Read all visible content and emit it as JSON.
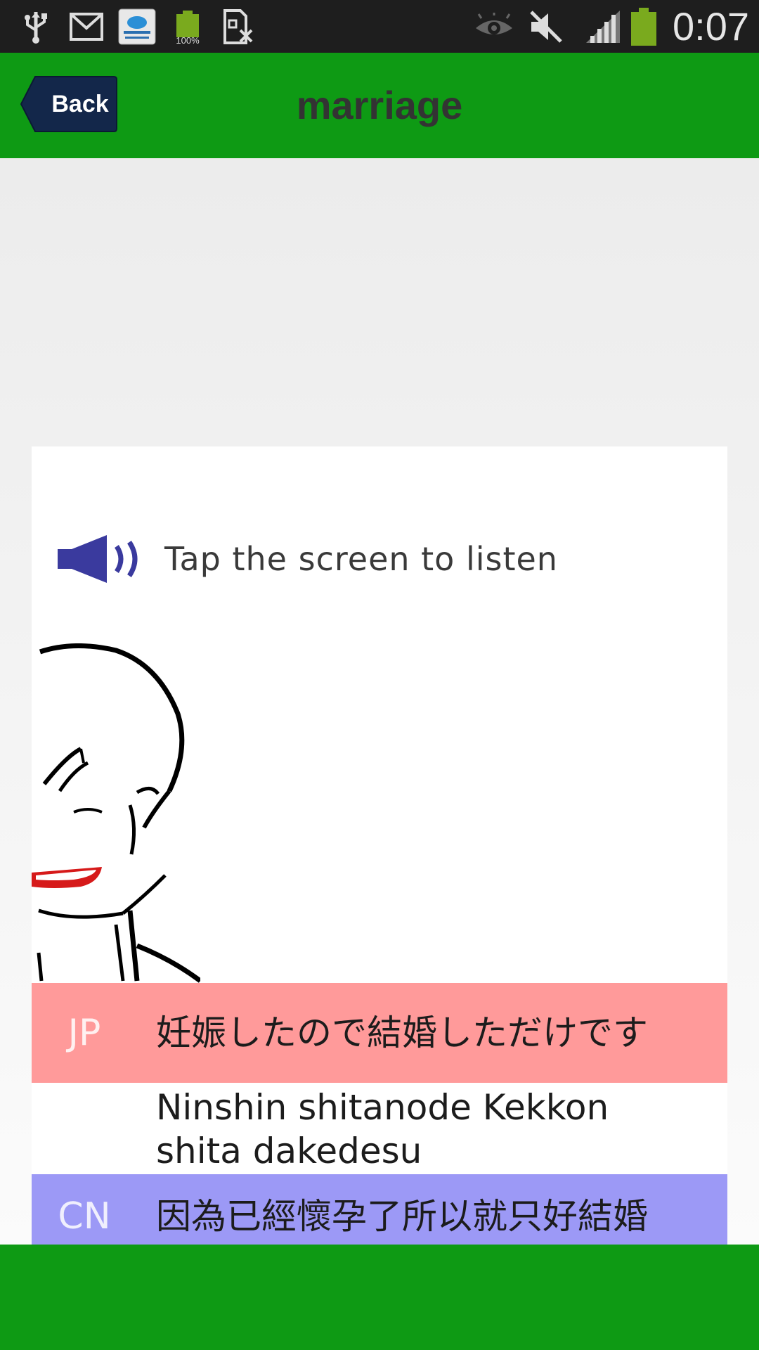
{
  "status_bar": {
    "time": "0:07",
    "icons": [
      "usb-icon",
      "gmail-icon",
      "cloud-testing-app-icon",
      "battery-100-icon",
      "sim-missing-icon",
      "eye-icon",
      "mute-icon",
      "signal-icon",
      "battery-icon"
    ],
    "app_icon_text": "100%"
  },
  "header": {
    "back_label": "Back",
    "title": "marriage"
  },
  "card": {
    "listen_text": "Tap the screen to listen",
    "jp_tag": "JP",
    "jp_text": "妊娠したので結婚しただけです",
    "romaji_line1": "Ninshin shitanode Kekkon",
    "romaji_line2": "shita dakedesu",
    "cn_tag": "CN",
    "cn_text": "因為已經懷孕了所以就只好結婚"
  },
  "colors": {
    "header_green": "#0e9a14",
    "back_button": "#13274a",
    "jp_row": "#ff9a9a",
    "cn_row": "#9c99f6",
    "speaker": "#3a3a9e"
  }
}
